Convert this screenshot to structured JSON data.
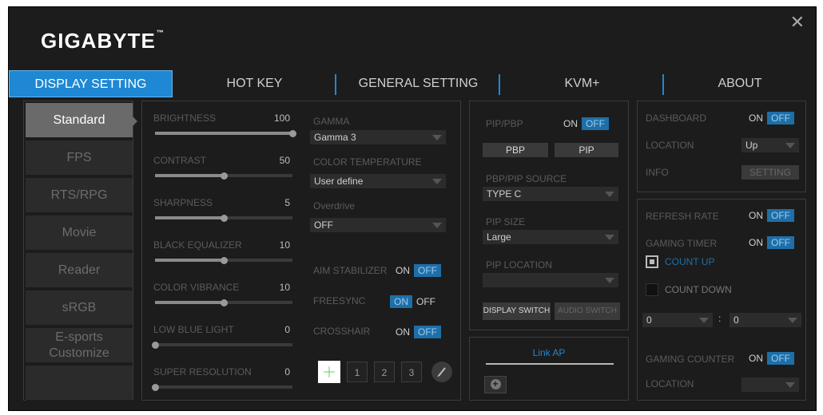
{
  "app": {
    "logo": "GIGABYTE",
    "trademark": "™",
    "close": "✕"
  },
  "tabs": [
    "DISPLAY SETTING",
    "HOT KEY",
    "GENERAL SETTING",
    "KVM+",
    "ABOUT"
  ],
  "modes": [
    "Standard",
    "FPS",
    "RTS/RPG",
    "Movie",
    "Reader",
    "sRGB",
    "E-sports\nCustomize"
  ],
  "sliders": [
    {
      "label": "BRIGHTNESS",
      "value": "100",
      "fraction": 1.0
    },
    {
      "label": "CONTRAST",
      "value": "50",
      "fraction": 0.5
    },
    {
      "label": "SHARPNESS",
      "value": "5",
      "fraction": 0.5
    },
    {
      "label": "BLACK EQUALIZER",
      "value": "10",
      "fraction": 0.5
    },
    {
      "label": "COLOR VIBRANCE",
      "value": "10",
      "fraction": 0.5
    },
    {
      "label": "LOW BLUE LIGHT",
      "value": "0",
      "fraction": 0.0
    },
    {
      "label": "SUPER RESOLUTION",
      "value": "0",
      "fraction": 0.0
    }
  ],
  "gamma": {
    "label": "GAMMA",
    "value": "Gamma 3"
  },
  "color_temp": {
    "label": "COLOR TEMPERATURE",
    "value": "User define"
  },
  "overdrive": {
    "label": "Overdrive",
    "value": "OFF"
  },
  "aim": {
    "label": "AIM STABILIZER",
    "on": "ON",
    "off": "OFF",
    "state": "OFF"
  },
  "freesync": {
    "label": "FREESYNC",
    "on": "ON",
    "off": "OFF",
    "state": "ON"
  },
  "crosshair": {
    "label": "CROSSHAIR",
    "on": "ON",
    "off": "OFF",
    "state": "OFF",
    "options": [
      "1",
      "2",
      "3"
    ]
  },
  "pip": {
    "pipbp_label": "PIP/PBP",
    "on": "ON",
    "off": "OFF",
    "state": "OFF",
    "pbp": "PBP",
    "pip": "PIP",
    "source_label": "PBP/PIP SOURCE",
    "source": "TYPE C",
    "size_label": "PIP SIZE",
    "size": "Large",
    "location_label": "PIP LOCATION",
    "location": "",
    "display_switch": "DISPLAY SWITCH",
    "audio_switch": "AUDIO SWITCH"
  },
  "link": {
    "label": "Link AP",
    "add": "+"
  },
  "dashboard": {
    "label": "DASHBOARD",
    "on": "ON",
    "off": "OFF",
    "state": "OFF",
    "location_label": "LOCATION",
    "location": "Up",
    "info_label": "INFO",
    "setting": "SETTING"
  },
  "timer": {
    "refresh_label": "REFRESH RATE",
    "refresh_state": "OFF",
    "timer_label": "GAMING TIMER",
    "timer_state": "OFF",
    "count_up": "COUNT UP",
    "count_down": "COUNT DOWN",
    "min": "0",
    "sep": ":",
    "sec": "0",
    "counter_label": "GAMING COUNTER",
    "counter_state": "OFF",
    "location_label": "LOCATION",
    "location": "",
    "on": "ON",
    "off": "OFF"
  },
  "colors": {
    "accent": "#1e88d4",
    "toggle_on": "#1e6fa8",
    "bg": "#1c1c1c"
  }
}
